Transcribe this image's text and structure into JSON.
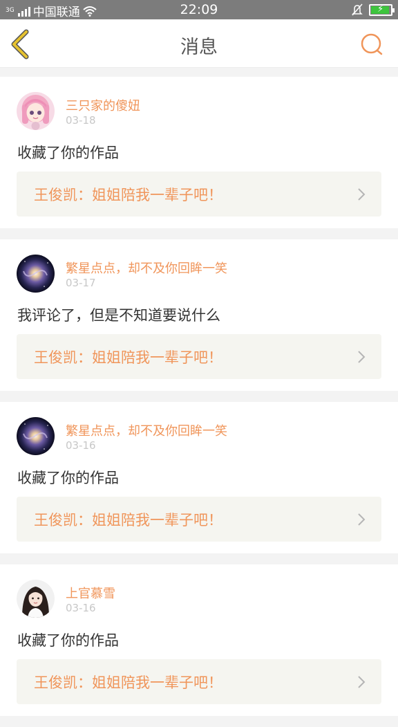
{
  "status": {
    "network": "3G",
    "carrier": "中国联通",
    "time": "22:09",
    "icons": [
      "signal-icon",
      "wifi-icon",
      "mute-icon",
      "battery-charging-icon"
    ]
  },
  "header": {
    "title": "消息",
    "back_icon": "chevron-left-icon",
    "search_icon": "search-icon",
    "accent": "#f0955a",
    "back_color": "#e6c230"
  },
  "messages": [
    {
      "user": "三只家的傻妞",
      "date": "03-18",
      "text": "收藏了你的作品",
      "work": "王俊凯：姐姐陪我一辈子吧！",
      "avatar": "anime-girl-avatar"
    },
    {
      "user": "繁星点点，却不及你回眸一笑",
      "date": "03-17",
      "text": "我评论了，但是不知道要说什么",
      "work": "王俊凯：姐姐陪我一辈子吧！",
      "avatar": "galaxy-avatar"
    },
    {
      "user": "繁星点点，却不及你回眸一笑",
      "date": "03-16",
      "text": "收藏了你的作品",
      "work": "王俊凯：姐姐陪我一辈子吧！",
      "avatar": "galaxy-avatar"
    },
    {
      "user": "上官慕雪",
      "date": "03-16",
      "text": "收藏了你的作品",
      "work": "王俊凯：姐姐陪我一辈子吧！",
      "avatar": "portrait-avatar"
    }
  ]
}
